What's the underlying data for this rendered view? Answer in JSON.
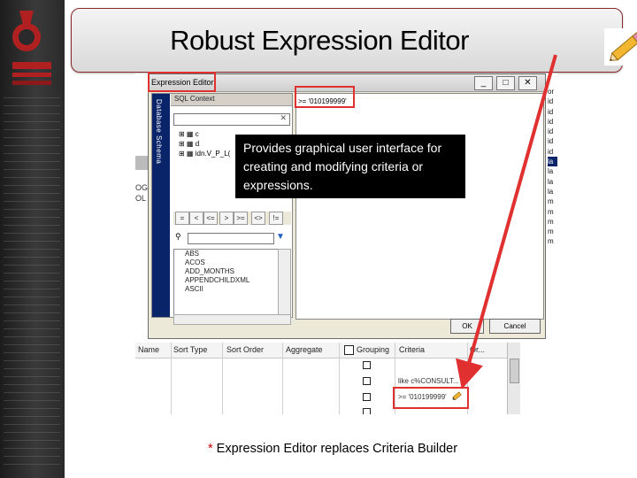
{
  "slide": {
    "title": "Robust Expression Editor",
    "footnote_star": "*",
    "footnote_text": " Expression Editor replaces Criteria Builder",
    "logo_icon": "just-logo-icon",
    "title_icon": "pencil-icon"
  },
  "tooltip": {
    "text": "Provides graphical user interface for creating and modifying criteria or expressions."
  },
  "dialog": {
    "title": "Expression Editor",
    "window_buttons": [
      "_",
      "□",
      "✕"
    ],
    "expression_value": ">= '010199999'",
    "ok_label": "OK",
    "cancel_label": "Cancel",
    "database_schema_tab": "Database Schema",
    "sql_context_header": "SQL Context",
    "tree_items": [
      "c",
      "d",
      "idn.V_P_L("
    ],
    "operators": [
      "=",
      "<",
      "<=",
      ">",
      ">=",
      "<>",
      "!="
    ],
    "functions": [
      "ABS",
      "ACOS",
      "ADD_MONTHS",
      "APPENDCHILDXML",
      "ASCII"
    ]
  },
  "background_grid": {
    "headers": [
      "Name",
      "Sort Type",
      "Sort Order",
      "Aggregate",
      "Grouping",
      "Criteria",
      "Or..."
    ],
    "criteria_rows": [
      "",
      "",
      "like c%CONSULT...",
      ">= '010199999'"
    ],
    "left_labels": [
      "OG",
      "OL"
    ],
    "right_labels": [
      "or",
      "id",
      "id",
      "id",
      "id",
      "id",
      "id",
      "la",
      "la",
      "la",
      "la",
      "m",
      "m",
      "m",
      "m",
      "m"
    ]
  },
  "colors": {
    "highlight_red": "#e03030",
    "sidebar_dark": "#2a2a2a",
    "title_border": "#8a2a2a",
    "tab_blue": "#0a246a"
  }
}
